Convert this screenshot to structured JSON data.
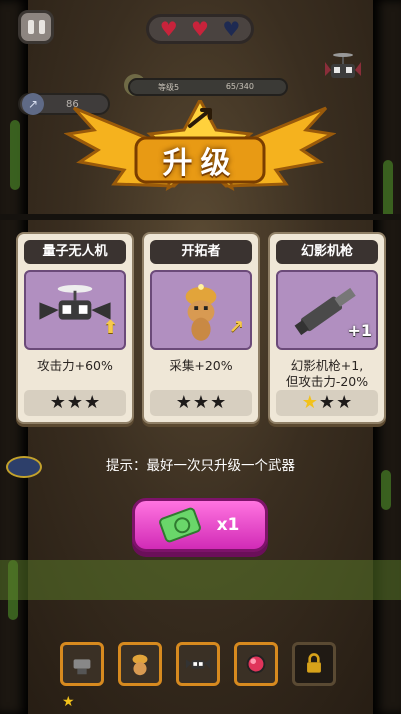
{
  "hud": {
    "hearts": [
      {
        "state": "full"
      },
      {
        "state": "full"
      },
      {
        "state": "empty"
      }
    ],
    "level_label": "等级5",
    "xp_text": "65/340",
    "attack_value": "86"
  },
  "title": "升级",
  "cards": [
    {
      "name": "量子无人机",
      "description": "攻击力+60%",
      "stars_filled": 0,
      "stars_total": 3,
      "badge": "up-arrow"
    },
    {
      "name": "开拓者",
      "description": "采集+20%",
      "stars_filled": 0,
      "stars_total": 3,
      "badge": "up-arrow"
    },
    {
      "name": "幻影机枪",
      "description_line1": "幻影机枪+1,",
      "description_line2": "但攻击力-20%",
      "stars_filled": 1,
      "stars_total": 3,
      "badge": "+1"
    }
  ],
  "hint": "提示：最好一次只升级一个武器",
  "reroll_button": {
    "count_label": "x1"
  },
  "inventory": {
    "slots": [
      {
        "icon": "machine-gun-icon"
      },
      {
        "icon": "pioneer-icon"
      },
      {
        "icon": "drone-icon"
      },
      {
        "icon": "red-orb-icon"
      },
      {
        "icon": "lock-icon"
      }
    ]
  },
  "colors": {
    "accent": "#d12bb6",
    "star": "#f2c21b",
    "card": "#efe7d7"
  }
}
